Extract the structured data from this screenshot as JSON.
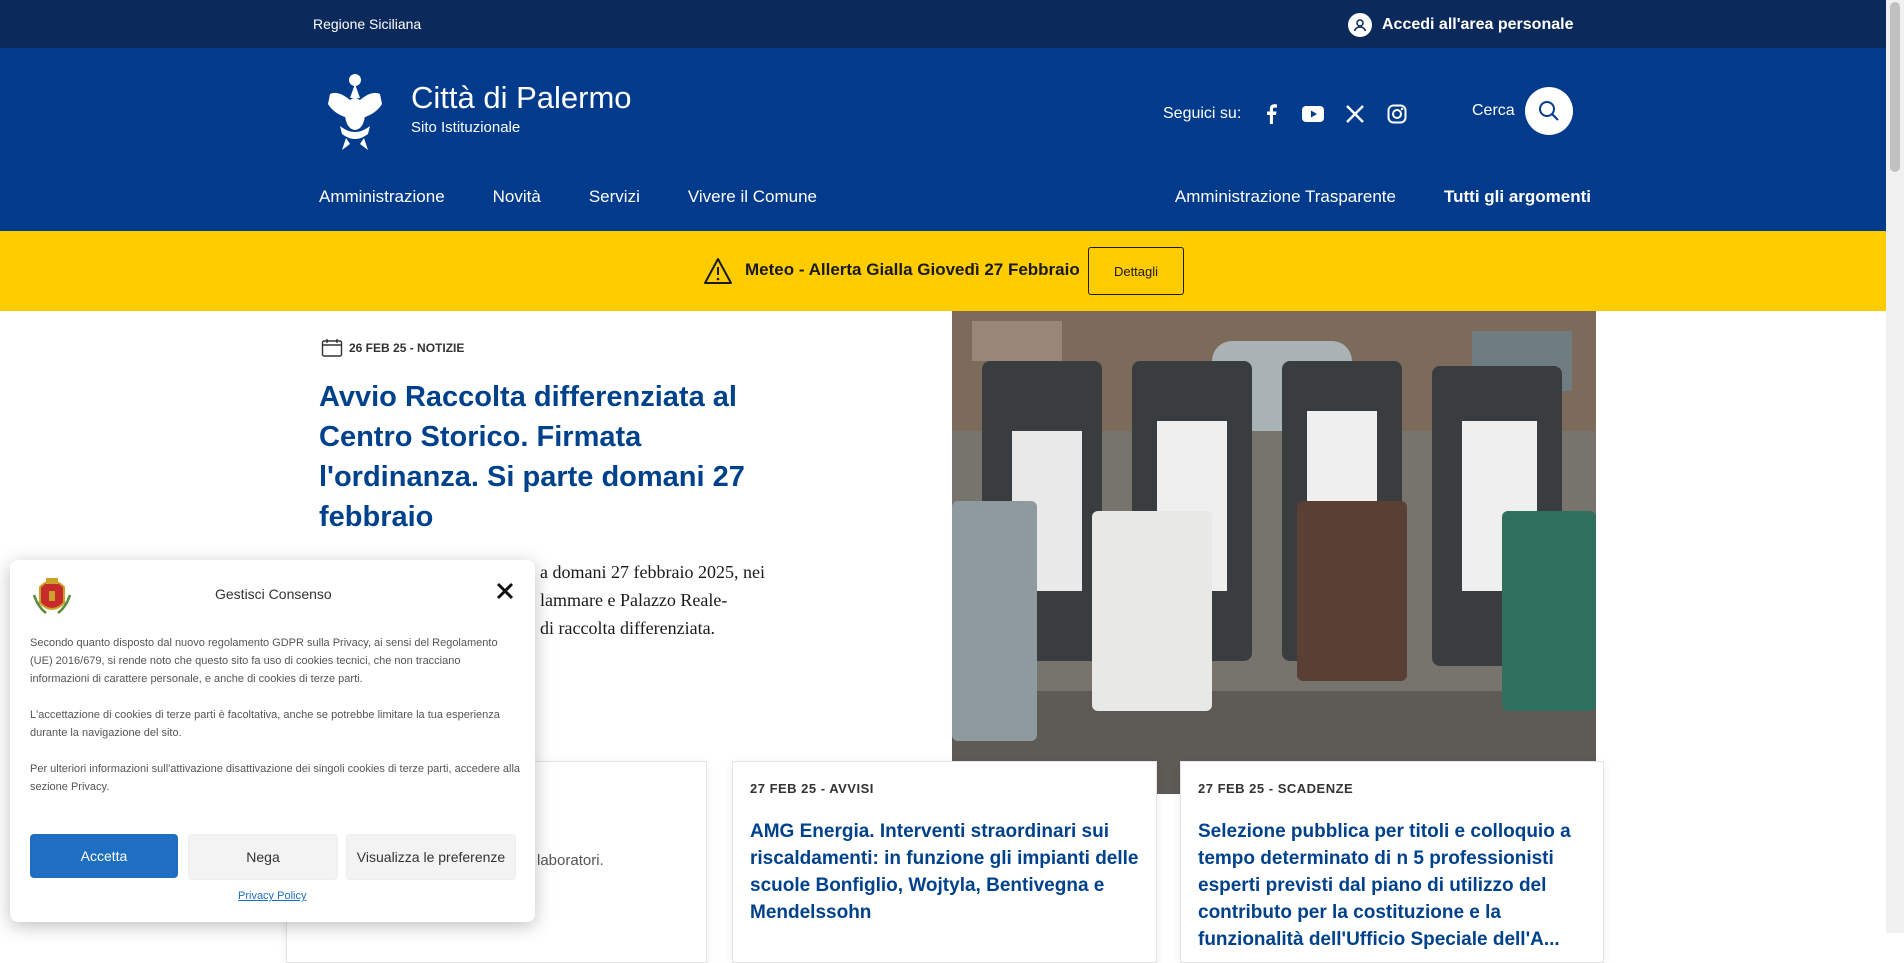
{
  "topbar": {
    "region": "Regione Siciliana",
    "login": "Accedi all'area personale"
  },
  "header": {
    "title": "Città di Palermo",
    "subtitle": "Sito Istituzionale",
    "social_label": "Seguici su:",
    "search_label": "Cerca",
    "nav_left": [
      "Amministrazione",
      "Novità",
      "Servizi",
      "Vivere il Comune"
    ],
    "nav_right": [
      "Amministrazione Trasparente",
      "Tutti gli argomenti"
    ]
  },
  "alert": {
    "message": "Meteo - Allerta Gialla Giovedì 27 Febbraio",
    "button": "Dettagli"
  },
  "hero": {
    "meta": "26 FEB 25 - NOTIZIE",
    "title": "Avvio Raccolta differenziata al Centro Storico. Firmata l'ordinanza. Si parte domani 27 febbraio",
    "lead_1": "a domani 27 febbraio 2025, nei",
    "lead_2": "lammare e Palazzo Reale-",
    "lead_3": "di raccolta differenziata."
  },
  "cards": [
    {
      "meta": "",
      "title": "",
      "text": "laboratori."
    },
    {
      "meta": "27 FEB 25 - AVVISI",
      "title": "AMG Energia. Interventi straordinari sui riscaldamenti: in funzione gli impianti delle scuole Bonfiglio, Wojtyla, Bentivegna e Mendelssohn"
    },
    {
      "meta": "27 FEB 25 - SCADENZE",
      "title": "Selezione pubblica per titoli e colloquio a tempo determinato di n 5 professionisti esperti previsti dal piano di utilizzo del contributo per la costituzione e la funzionalità dell'Ufficio Speciale dell'A..."
    }
  ],
  "consent": {
    "title": "Gestisci Consenso",
    "p1": "Secondo quanto disposto dal nuovo regolamento GDPR sulla Privacy, ai sensi del Regolamento (UE) 2016/679, si rende noto che questo sito fa uso di cookies tecnici, che non tracciano informazioni di carattere personale, e anche di cookies di terze parti.",
    "p2": "L'accettazione di cookies di terze parti è facoltativa, anche se potrebbe limitare la tua esperienza durante la navigazione del sito.",
    "p3": "Per ulteriori informazioni sull'attivazione disattivazione dei singoli cookies di terze parti, accedere alla sezione Privacy.",
    "accept": "Accetta",
    "deny": "Nega",
    "preferences": "Visualizza le preferenze",
    "privacy_link": "Privacy Policy"
  },
  "colors": {
    "topbar": "#0b2a5b",
    "header": "#023b8c",
    "alert": "#ffcc00",
    "link": "#00418c",
    "accept": "#1e6fc2"
  },
  "icons": [
    "user-icon",
    "facebook-icon",
    "youtube-icon",
    "x-icon",
    "instagram-icon",
    "search-icon",
    "warning-icon",
    "calendar-icon",
    "close-icon"
  ]
}
